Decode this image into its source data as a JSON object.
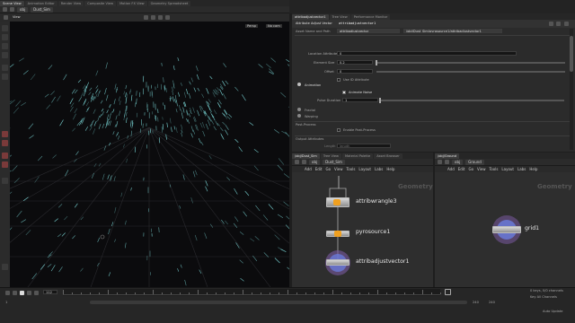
{
  "left_panel": {
    "tabs": [
      "Scene View",
      "Animation Editor",
      "Render View",
      "Composite View",
      "Motion FX View",
      "Geometry Spreadsheet"
    ],
    "path": {
      "root": "obj",
      "node": "Dust_Sim"
    },
    "view_label": "View",
    "persp_label": "Persp",
    "cam_label": "No cam"
  },
  "params_panel": {
    "tabs": [
      "attribadjustvector1",
      "Tree View",
      "Performance Monitor"
    ],
    "node_type": "Attribute Adjust Vector",
    "node_name": "attribadjustvector1",
    "row1_label": "Asset Name and Path",
    "row1_value": "attribadjustvector",
    "row1_path": "/obj/Dust_Sim/pyrosource1/attribadjustvector1",
    "location_label": "Location Attribute",
    "location_value": "0",
    "element_size_label": "Element Size",
    "element_size_value": "0.2",
    "offset_label": "Offset",
    "offset_value": "0",
    "use_id_label": "Use ID Attribute",
    "animation_label": "Animation",
    "animate_noise_label": "Animate Noise",
    "pulse_label": "Pulse Duration",
    "pulse_value": "1",
    "fractal_label": "Fractal",
    "warping_label": "Warping",
    "post_process_label": "Post-Process",
    "enable_post_label": "Enable Post-Process",
    "output_label": "Output Attributes",
    "length_label": "Length",
    "length_value": "length"
  },
  "network_left": {
    "tabs": [
      "/obj/Dust_Sim",
      "Tree View",
      "Material Palette",
      "Asset Browser"
    ],
    "path": {
      "root": "obj",
      "node": "Dust_Sim"
    },
    "menu": [
      "Add",
      "Edit",
      "Go",
      "View",
      "Tools",
      "Layout",
      "Labs",
      "Help"
    ],
    "context_label": "Geometry",
    "nodes": [
      "attribwrangle3",
      "pyrosource1",
      "attribadjustvector1"
    ]
  },
  "network_right": {
    "tabs": [
      "/obj/Ground"
    ],
    "path": {
      "root": "obj",
      "node": "Ground"
    },
    "menu": [
      "Add",
      "Edit",
      "Go",
      "View",
      "Tools",
      "Layout",
      "Labs",
      "Help"
    ],
    "context_label": "Geometry",
    "nodes": [
      "grid1"
    ]
  },
  "timeline": {
    "frame": "112",
    "start": "1",
    "end": "240",
    "end2": "240",
    "keys_label": "0 keys, 0/0 channels",
    "key_all_label": "Key All Channels",
    "auto_update": "Auto Update"
  },
  "colors": {
    "accent": "#f0a020",
    "node_ring": "#5a6bd8",
    "particles": "#7fe0e0"
  }
}
